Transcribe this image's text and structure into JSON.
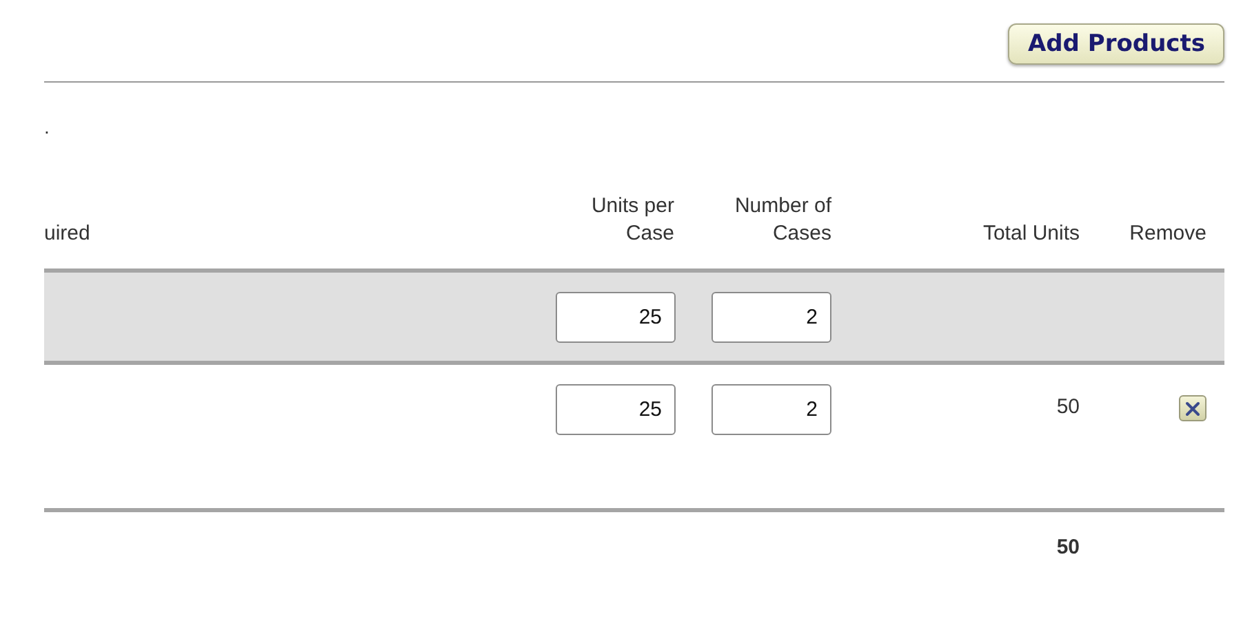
{
  "toolbar": {
    "add_button": "Add Products"
  },
  "note": ".",
  "table": {
    "columns": [
      "uired",
      "Units per Case",
      "Number of Cases",
      "Total Units",
      "Remove"
    ],
    "rows": [
      {
        "selected": true,
        "units_per_case": "25",
        "number_of_cases": "2",
        "removable": false
      },
      {
        "selected": false,
        "units_per_case": "25",
        "number_of_cases": "2",
        "total_units": "50",
        "removable": true
      }
    ],
    "total": "50"
  }
}
